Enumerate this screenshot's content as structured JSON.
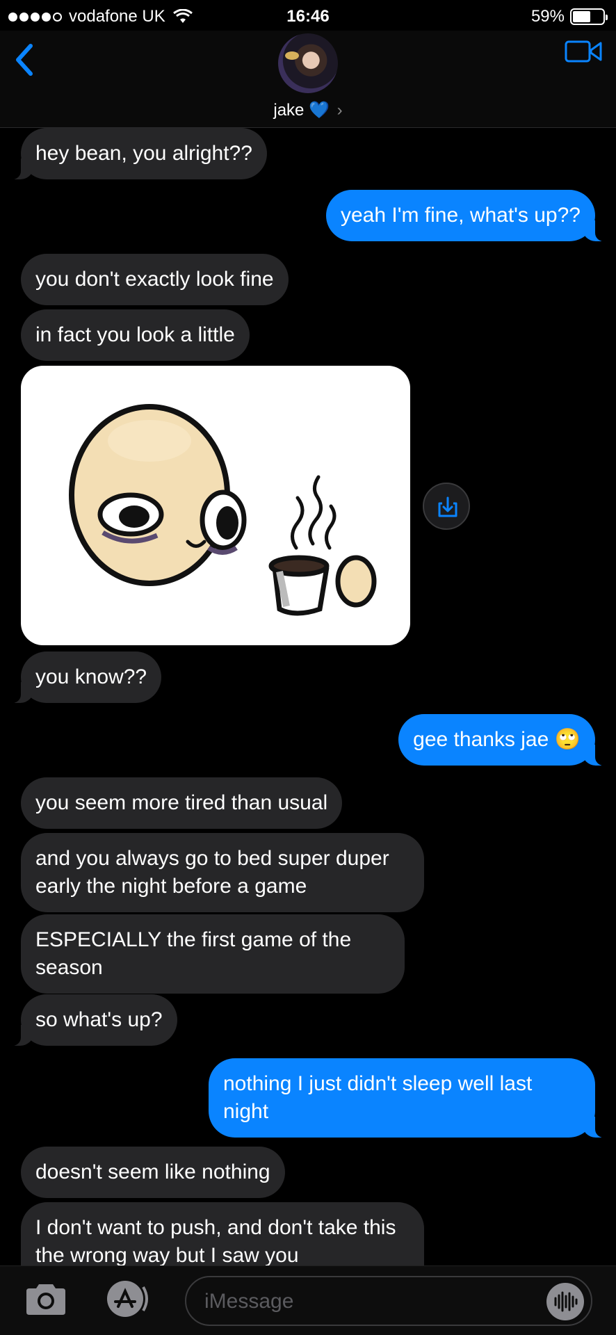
{
  "status_bar": {
    "carrier": "vodafone UK",
    "time": "16:46",
    "battery": "59%",
    "battery_level": 0.59
  },
  "header": {
    "contact_name": "jake",
    "contact_emoji": "💙",
    "chevron": "›"
  },
  "messages": [
    {
      "dir": "in",
      "text": "hey bean, you alright??"
    },
    {
      "dir": "out",
      "text": "yeah I'm fine, what's up??"
    },
    {
      "dir": "in",
      "text": "you don't exactly look fine"
    },
    {
      "dir": "in",
      "text": "in fact you look a little"
    },
    {
      "dir": "in",
      "text": "you know??"
    },
    {
      "dir": "out",
      "text": "gee thanks jae 🙄"
    },
    {
      "dir": "in",
      "text": "you seem more tired than usual"
    },
    {
      "dir": "in",
      "text": "and you always go to bed super duper early the night before a game"
    },
    {
      "dir": "in",
      "text": "ESPECIALLY the first game of the season"
    },
    {
      "dir": "in",
      "text": "so what's up?"
    },
    {
      "dir": "out",
      "text": "nothing I just didn't sleep well last night"
    },
    {
      "dir": "in",
      "text": "doesn't seem like nothing"
    },
    {
      "dir": "in",
      "text": "I don't want to push, and don't take this the wrong way but I saw you"
    }
  ],
  "input": {
    "placeholder": "iMessage"
  },
  "icons": {
    "back": "chevron-left-icon",
    "video": "video-camera-icon",
    "camera": "camera-icon",
    "appstore": "app-store-icon",
    "audio": "audio-waveform-icon",
    "save": "save-image-icon"
  },
  "colors": {
    "outgoing_bubble": "#0a84ff",
    "incoming_bubble": "#262628",
    "accent": "#0a84ff"
  }
}
